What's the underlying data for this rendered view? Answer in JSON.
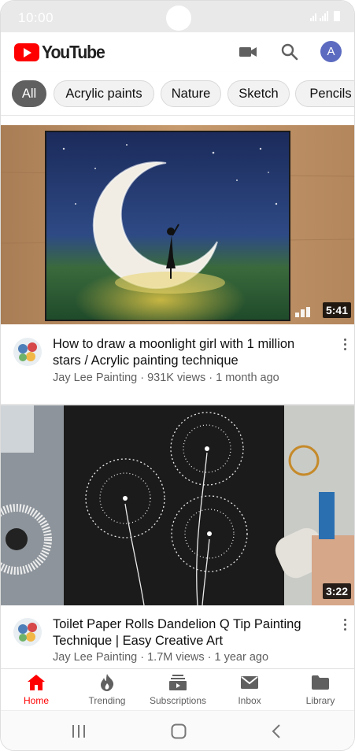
{
  "status_bar": {
    "time": "10:00"
  },
  "header": {
    "logo_text": "YouTube",
    "icons": [
      "video-camera-icon",
      "search-icon"
    ],
    "avatar_letter": "A"
  },
  "chips": [
    {
      "label": "All",
      "active": true
    },
    {
      "label": "Acrylic paints",
      "active": false
    },
    {
      "label": "Nature",
      "active": false
    },
    {
      "label": "Sketch",
      "active": false
    },
    {
      "label": "Pencils",
      "active": false
    }
  ],
  "videos": [
    {
      "duration": "5:41",
      "title": "How to draw a moonlight girl with 1 million stars / Acrylic painting technique",
      "channel_line": "Jay Lee Painting · 931K views · 1 month ago"
    },
    {
      "duration": "3:22",
      "title": "Toilet Paper Rolls Dandelion Q Tip Painting Technique |  Easy Creative Art",
      "channel_line": "Jay Lee Painting · 1.7M views · 1 year ago"
    }
  ],
  "bottom_nav": [
    {
      "label": "Home",
      "icon": "home-icon",
      "active": true
    },
    {
      "label": "Trending",
      "icon": "flame-icon",
      "active": false
    },
    {
      "label": "Subscriptions",
      "icon": "subscriptions-icon",
      "active": false
    },
    {
      "label": "Inbox",
      "icon": "mail-icon",
      "active": false
    },
    {
      "label": "Library",
      "icon": "folder-icon",
      "active": false
    }
  ],
  "colors": {
    "brand_red": "#ff0000",
    "active_chip": "#606060",
    "meta_gray": "#606060"
  }
}
